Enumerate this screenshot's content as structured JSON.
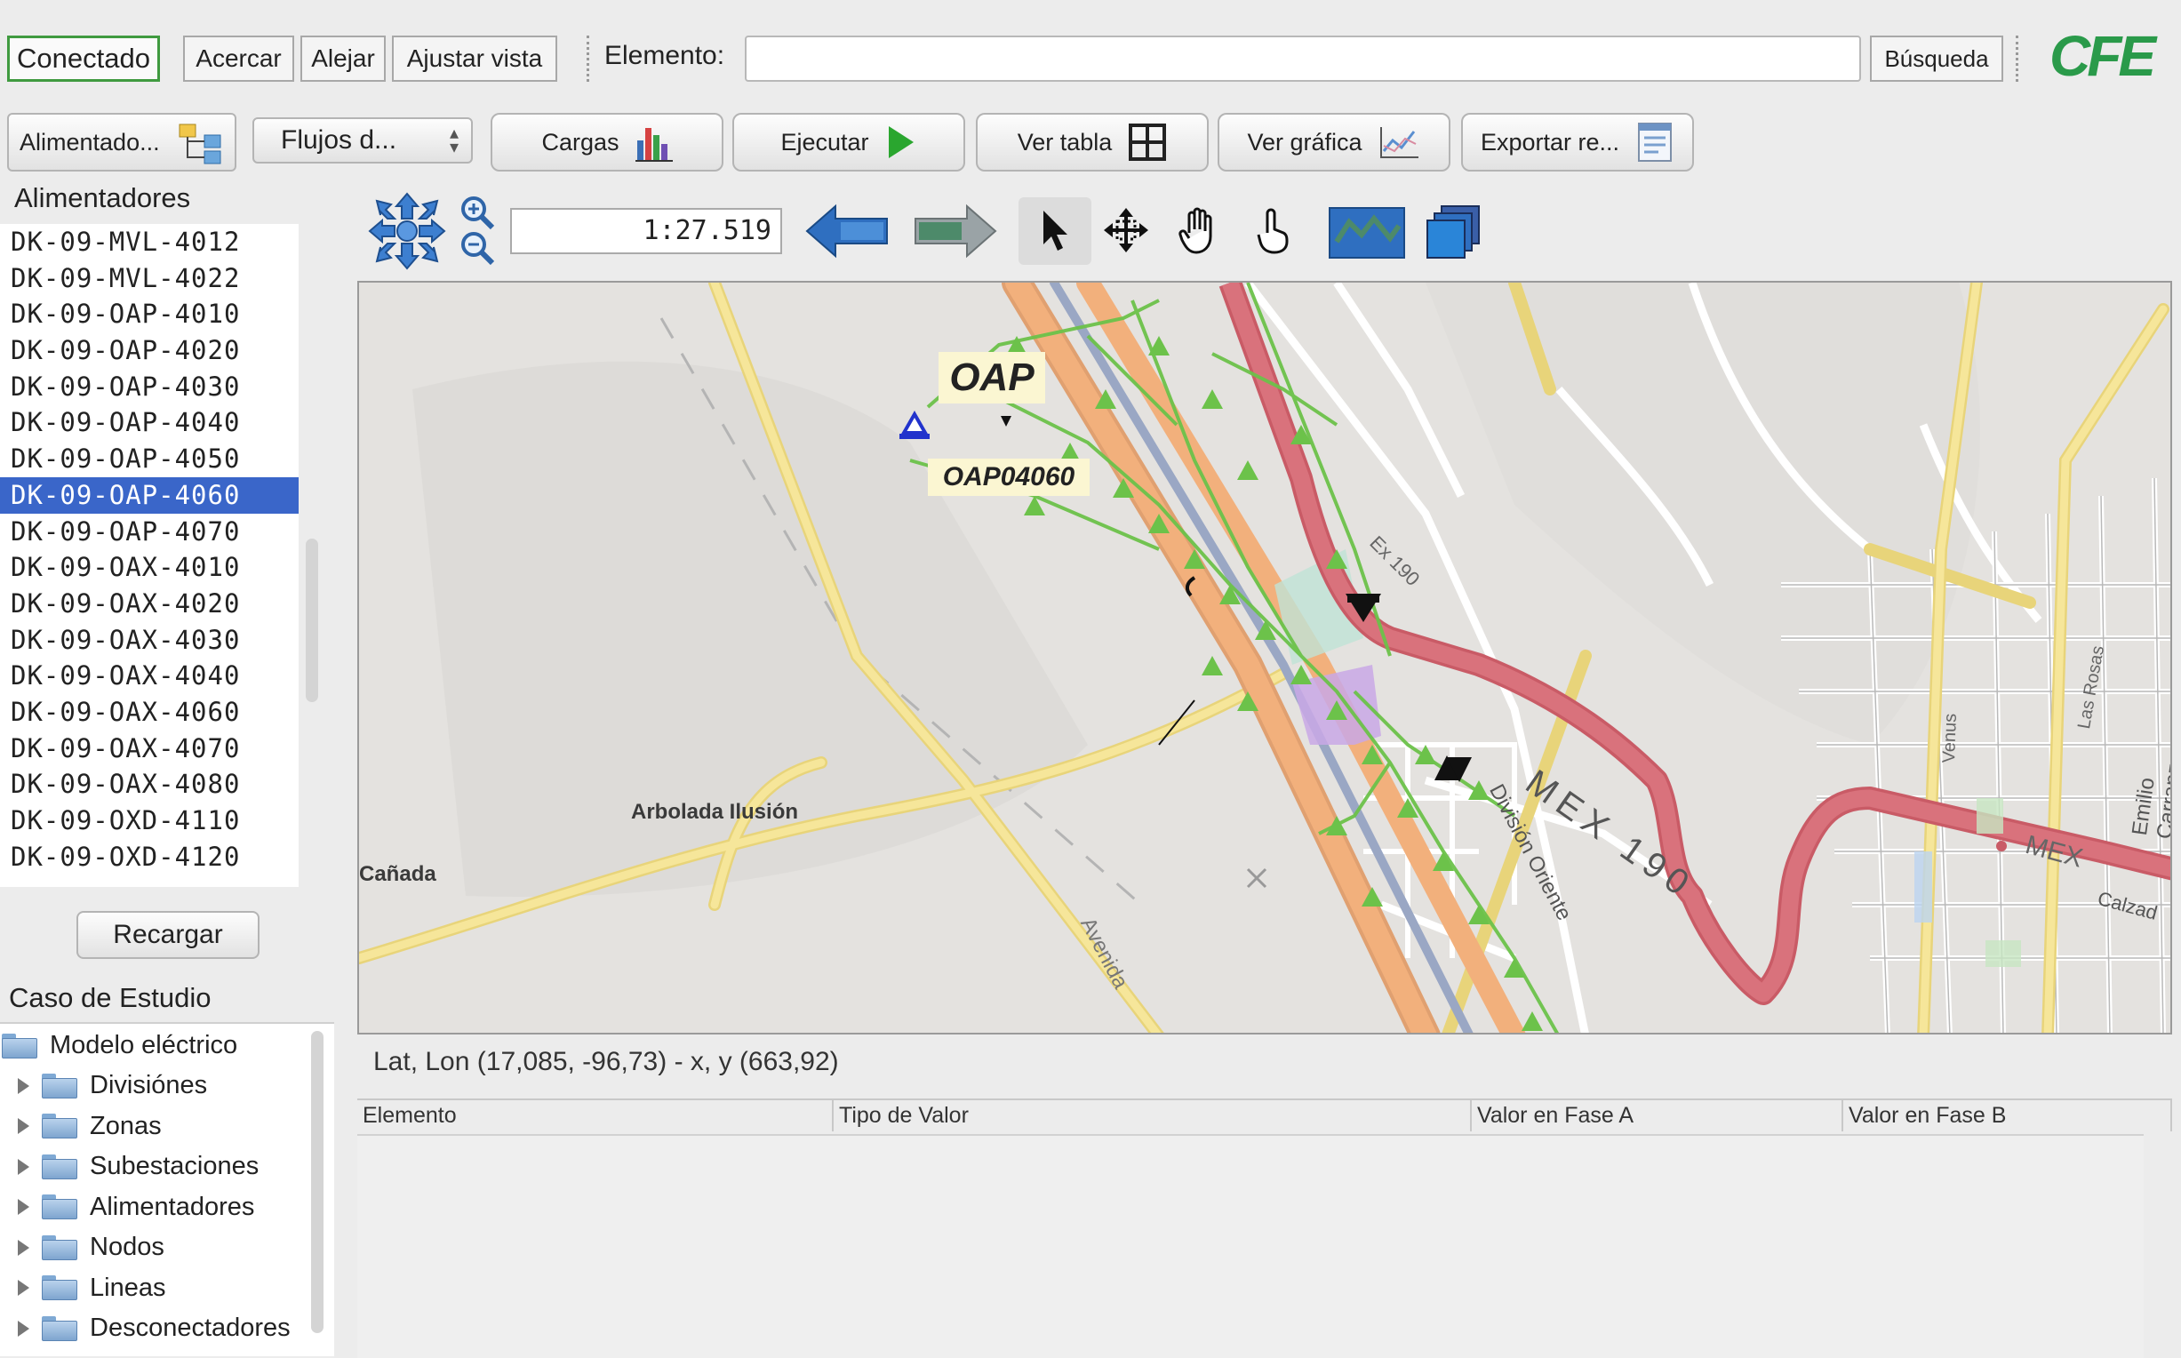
{
  "toolbar_top": {
    "status": "Conectado",
    "zoom_in": "Acercar",
    "zoom_out": "Alejar",
    "fit_view": "Ajustar vista",
    "element_label": "Elemento:",
    "element_value": "",
    "search": "Búsqueda",
    "logo": "CFE"
  },
  "toolbar_main": {
    "feeder_select": "Alimentado...",
    "flow_select": "Flujos d...",
    "loads": "Cargas",
    "run": "Ejecutar",
    "view_table": "Ver tabla",
    "view_chart": "Ver gráfica",
    "export": "Exportar re..."
  },
  "feeders": {
    "title": "Alimentadores",
    "items": [
      "DK-09-MVL-4012",
      "DK-09-MVL-4022",
      "DK-09-OAP-4010",
      "DK-09-OAP-4020",
      "DK-09-OAP-4030",
      "DK-09-OAP-4040",
      "DK-09-OAP-4050",
      "DK-09-OAP-4060",
      "DK-09-OAP-4070",
      "DK-09-OAX-4010",
      "DK-09-OAX-4020",
      "DK-09-OAX-4030",
      "DK-09-OAX-4040",
      "DK-09-OAX-4060",
      "DK-09-OAX-4070",
      "DK-09-OAX-4080",
      "DK-09-OXD-4110",
      "DK-09-OXD-4120"
    ],
    "selected": "DK-09-OAP-4060",
    "reload": "Recargar"
  },
  "case_study": {
    "title": "Caso de Estudio",
    "root": "Modelo eléctrico",
    "children": [
      "Divisiónes",
      "Zonas",
      "Subestaciones",
      "Alimentadores",
      "Nodos",
      "Lineas",
      "Desconectadores"
    ]
  },
  "map": {
    "scale": "1:27.519",
    "substation_label": "OAP",
    "feeder_label": "OAP04060",
    "place_labels": {
      "arbolada": "Arbolada Ilusión",
      "canada": "Cañada",
      "mex190": "MEX 190",
      "division": "División Oriente",
      "ex190": "Ex 190",
      "avenida": "Avenida",
      "venus": "Venus",
      "lasrosas": "Las Rosas",
      "carranza": "Emilio Carranza",
      "calzada": "Calzad",
      "mex": "MEX"
    },
    "colors": {
      "background": "#e4e2df",
      "highway_red": "#d9727c",
      "highway_orange": "#f2b07c",
      "road_yellow": "#f6e69a",
      "network_green": "#6cc24a",
      "selection_blue": "#3a66c9"
    }
  },
  "status": {
    "coords": "Lat, Lon (17,085, -96,73) - x, y (663,92)"
  },
  "results_table": {
    "columns": [
      "Elemento",
      "Tipo de Valor",
      "Valor en Fase A",
      "Valor en Fase B"
    ],
    "rows": []
  }
}
